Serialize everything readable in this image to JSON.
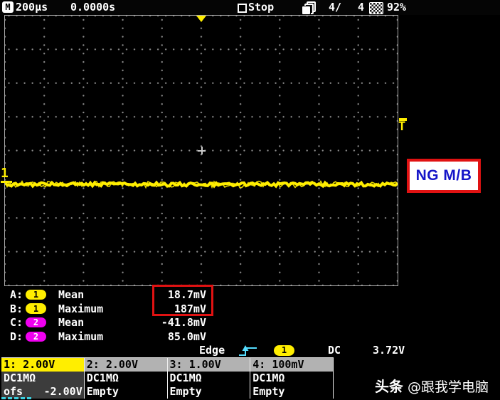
{
  "top_bar": {
    "timebase_icon": "M",
    "timebase": "200µs",
    "delay": "0.0000s",
    "acq_state": "Stop",
    "history_current": "4/",
    "history_total": "4",
    "battery": "92%"
  },
  "grid": {
    "ch1_marker": "1",
    "trigger_marker": "T"
  },
  "ng_label": "NG M/B",
  "measurements": {
    "rows": [
      {
        "label": "A:",
        "channel": "1",
        "name": "Mean",
        "value": "18.7mV"
      },
      {
        "label": "B:",
        "channel": "1",
        "name": "Maximum",
        "value": "187mV"
      },
      {
        "label": "C:",
        "channel": "2",
        "name": "Mean",
        "value": "-41.8mV"
      },
      {
        "label": "D:",
        "channel": "2",
        "name": "Maximum",
        "value": "85.0mV"
      }
    ]
  },
  "trigger": {
    "type": "Edge",
    "source": "1",
    "coupling": "DC",
    "level": "3.72V"
  },
  "channels": [
    {
      "header": "1: 2.00V",
      "coupling": "DC1MΩ",
      "line2_left": "ofs",
      "line2_right": "-2.00V"
    },
    {
      "header": "2: 2.00V",
      "coupling": "DC1MΩ",
      "line2_left": "Empty",
      "line2_right": ""
    },
    {
      "header": "3: 1.00V",
      "coupling": "DC1MΩ",
      "line2_left": "Empty",
      "line2_right": ""
    },
    {
      "header": "4: 100mV",
      "coupling": "DC1MΩ",
      "line2_left": "Empty",
      "line2_right": ""
    }
  ],
  "watermark": {
    "brand": "头条",
    "handle": "@跟我学电脑"
  },
  "colors": {
    "ch1_yellow": "#ffee00",
    "ch2_magenta": "#f000f0",
    "edge_cyan": "#55ddff",
    "alert_red": "#e01212",
    "ng_blue": "#1414c8"
  }
}
